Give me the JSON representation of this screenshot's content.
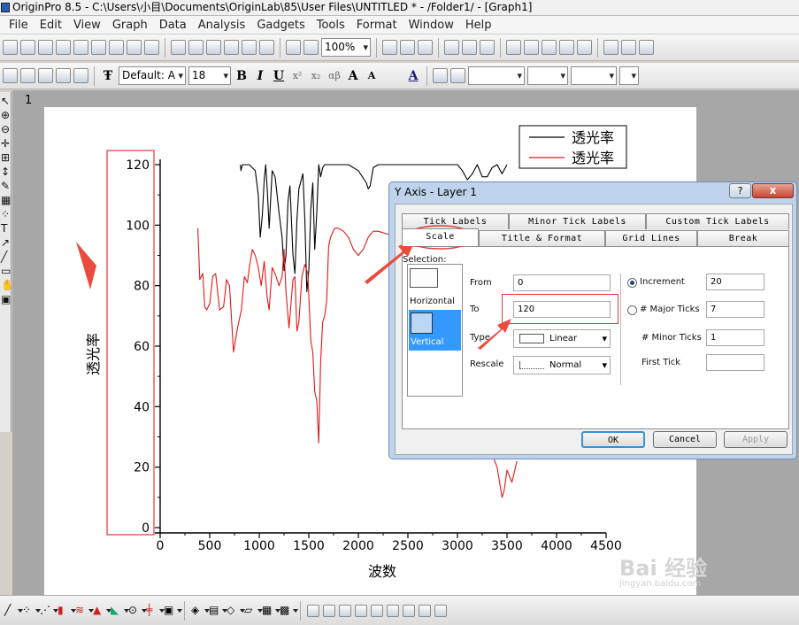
{
  "window": {
    "title": "OriginPro 8.5 - C:\\Users\\小目\\Documents\\OriginLab\\85\\User Files\\UNTITLED * - /Folder1/ - [Graph1]"
  },
  "menu": [
    "File",
    "Edit",
    "View",
    "Graph",
    "Data",
    "Analysis",
    "Gadgets",
    "Tools",
    "Format",
    "Window",
    "Help"
  ],
  "toolbar": {
    "zoom": "100%",
    "font_name": "Default: A",
    "font_size": "18",
    "bold": "B",
    "italic": "I",
    "underline": "U",
    "superscript": "x²",
    "subscript": "x₂",
    "greek": "αβ",
    "increase_font": "A",
    "decrease_font": "A",
    "font_color": "A"
  },
  "graph": {
    "page_number": "1",
    "xlabel": "波数",
    "ylabel": "透光率",
    "x_ticks": [
      "0",
      "500",
      "1000",
      "1500",
      "2000",
      "2500",
      "3000",
      "3500",
      "4000",
      "4500"
    ],
    "y_ticks": [
      "0",
      "20",
      "40",
      "60",
      "80",
      "100",
      "120"
    ],
    "legend": [
      {
        "name": "透光率",
        "color": "#000000"
      },
      {
        "name": "透光率",
        "color": "#e01818"
      }
    ]
  },
  "chart_data": {
    "type": "line",
    "xlabel": "波数",
    "ylabel": "透光率",
    "xlim": [
      0,
      4500
    ],
    "ylim": [
      0,
      120
    ],
    "series": [
      {
        "name": "透光率",
        "color": "#000000",
        "x": [
          810,
          815,
          830,
          900,
          960,
          990,
          1010,
          1030,
          1050,
          1065,
          1080,
          1100,
          1130,
          1160,
          1200,
          1230,
          1250,
          1270,
          1290,
          1310,
          1340,
          1360,
          1380,
          1400,
          1440,
          1460,
          1480,
          1500,
          1520,
          1540,
          1560,
          1580,
          1600,
          1620,
          1640,
          1660,
          1700,
          1750,
          1800,
          1900,
          2000,
          2080,
          2100,
          2120,
          2150,
          2200,
          2250,
          2300,
          2350,
          2400,
          2500,
          2600,
          2700,
          2800,
          2900,
          3000,
          3050,
          3100,
          3150,
          3200,
          3250,
          3300,
          3350,
          3400,
          3450,
          3500
        ],
        "y": [
          120,
          118,
          120,
          120,
          118,
          110,
          96,
          103,
          115,
          120,
          112,
          99,
          118,
          116,
          104,
          96,
          85,
          90,
          108,
          113,
          90,
          84,
          102,
          112,
          117,
          102,
          78,
          85,
          105,
          114,
          92,
          104,
          120,
          116,
          119,
          120,
          120,
          120,
          120,
          120,
          118,
          114,
          112,
          113,
          119,
          120,
          120,
          120,
          120,
          120,
          120,
          120,
          120,
          120,
          120,
          120,
          118,
          115,
          117,
          120,
          116,
          116,
          119,
          120,
          117,
          120
        ]
      },
      {
        "name": "透光率",
        "color": "#e01818",
        "x": [
          380,
          400,
          430,
          450,
          470,
          500,
          530,
          560,
          600,
          640,
          670,
          700,
          740,
          780,
          820,
          850,
          880,
          900,
          930,
          960,
          990,
          1020,
          1050,
          1080,
          1100,
          1130,
          1160,
          1200,
          1230,
          1250,
          1270,
          1300,
          1340,
          1360,
          1380,
          1400,
          1430,
          1460,
          1490,
          1520,
          1540,
          1560,
          1580,
          1600,
          1620,
          1640,
          1660,
          1680,
          1700,
          1720,
          1760,
          1800,
          1850,
          1900,
          1950,
          2000,
          2050,
          2100,
          2150,
          2200,
          2300,
          2500,
          3400,
          3450,
          3470,
          3500,
          3550,
          3600
        ],
        "y": [
          99,
          82,
          84,
          73,
          72,
          74,
          83,
          84,
          72,
          73,
          82,
          80,
          58,
          66,
          72,
          83,
          81,
          86,
          92,
          90,
          86,
          80,
          88,
          76,
          72,
          86,
          84,
          80,
          83,
          92,
          78,
          66,
          82,
          83,
          65,
          68,
          83,
          87,
          84,
          62,
          58,
          45,
          42,
          28,
          55,
          68,
          70,
          75,
          93,
          96,
          99,
          99,
          98,
          96,
          92,
          90,
          92,
          96,
          98,
          98,
          97,
          95,
          20,
          10,
          12,
          19,
          15,
          22
        ]
      }
    ]
  },
  "dialog": {
    "title": "Y Axis - Layer 1",
    "help_btn": "?",
    "close_btn": "x",
    "tabs_row1": [
      "Tick Labels",
      "Minor Tick Labels",
      "Custom Tick Labels"
    ],
    "tabs_row2": [
      "Scale",
      "Title & Format",
      "Grid Lines",
      "Break"
    ],
    "selection_label": "Selection:",
    "sel_horizontal": "Horizontal",
    "sel_vertical": "Vertical",
    "from_label": "From",
    "from_value": "0",
    "to_label": "To",
    "to_value": "120",
    "type_label": "Type",
    "type_value": "Linear",
    "rescale_label": "Rescale",
    "rescale_value": "Normal",
    "increment_label": "Increment",
    "increment_value": "20",
    "major_label": "# Major Ticks",
    "major_value": "7",
    "minor_label": "# Minor Ticks",
    "minor_value": "1",
    "first_tick_label": "First Tick",
    "first_tick_value": "",
    "ok": "OK",
    "cancel": "Cancel",
    "apply": "Apply"
  },
  "watermark": {
    "brand": "Bai 经验",
    "url": "jingyan.baidu.com"
  }
}
